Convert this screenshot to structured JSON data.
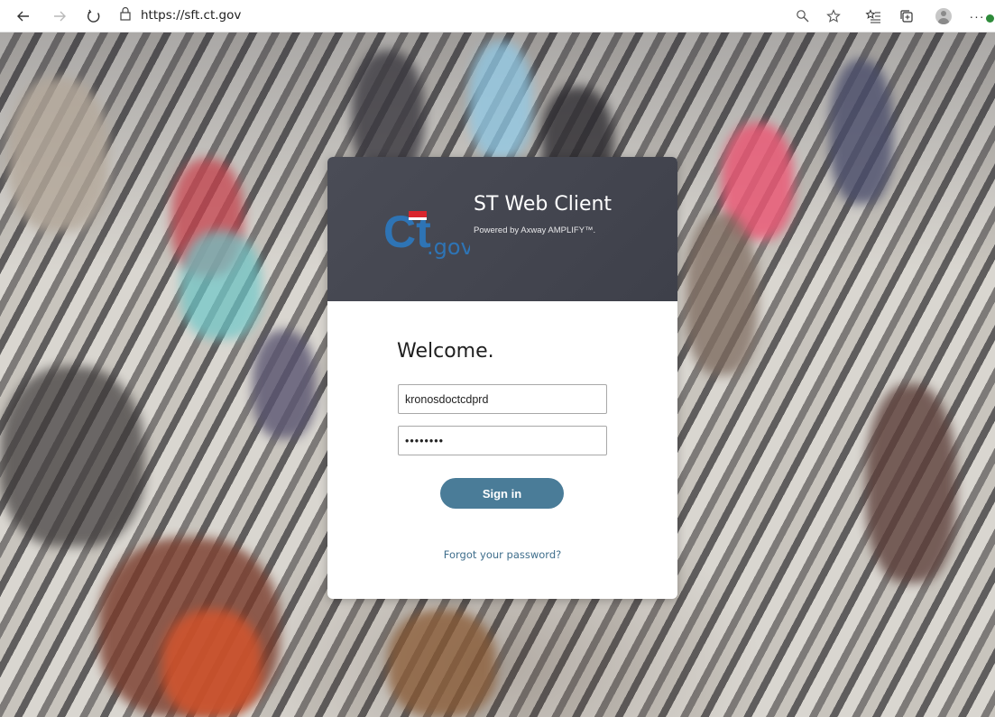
{
  "browser": {
    "url": "https://sft.ct.gov",
    "icons": {
      "back": "back-arrow-icon",
      "forward": "forward-arrow-icon",
      "refresh": "refresh-icon",
      "lock": "lock-icon",
      "search": "search-icon",
      "favorite": "star-icon",
      "favorites_list": "favorites-list-icon",
      "collections": "collections-icon",
      "profile": "profile-avatar-icon",
      "more": "more-options-icon"
    }
  },
  "login": {
    "app_title": "ST Web Client",
    "app_subtitle": "Powered by Axway AMPLIFY™.",
    "logo_text": "CT.gov",
    "welcome": "Welcome.",
    "username_value": "kronosdoctcdprd",
    "password_value": "••••••••",
    "sign_in_label": "Sign in",
    "forgot_label": "Forgot your password?"
  },
  "colors": {
    "card_header": "#45474f",
    "button": "#4a7c98",
    "link": "#3f6e8c",
    "logo_blue": "#2e74b5",
    "logo_red": "#d9262d"
  }
}
